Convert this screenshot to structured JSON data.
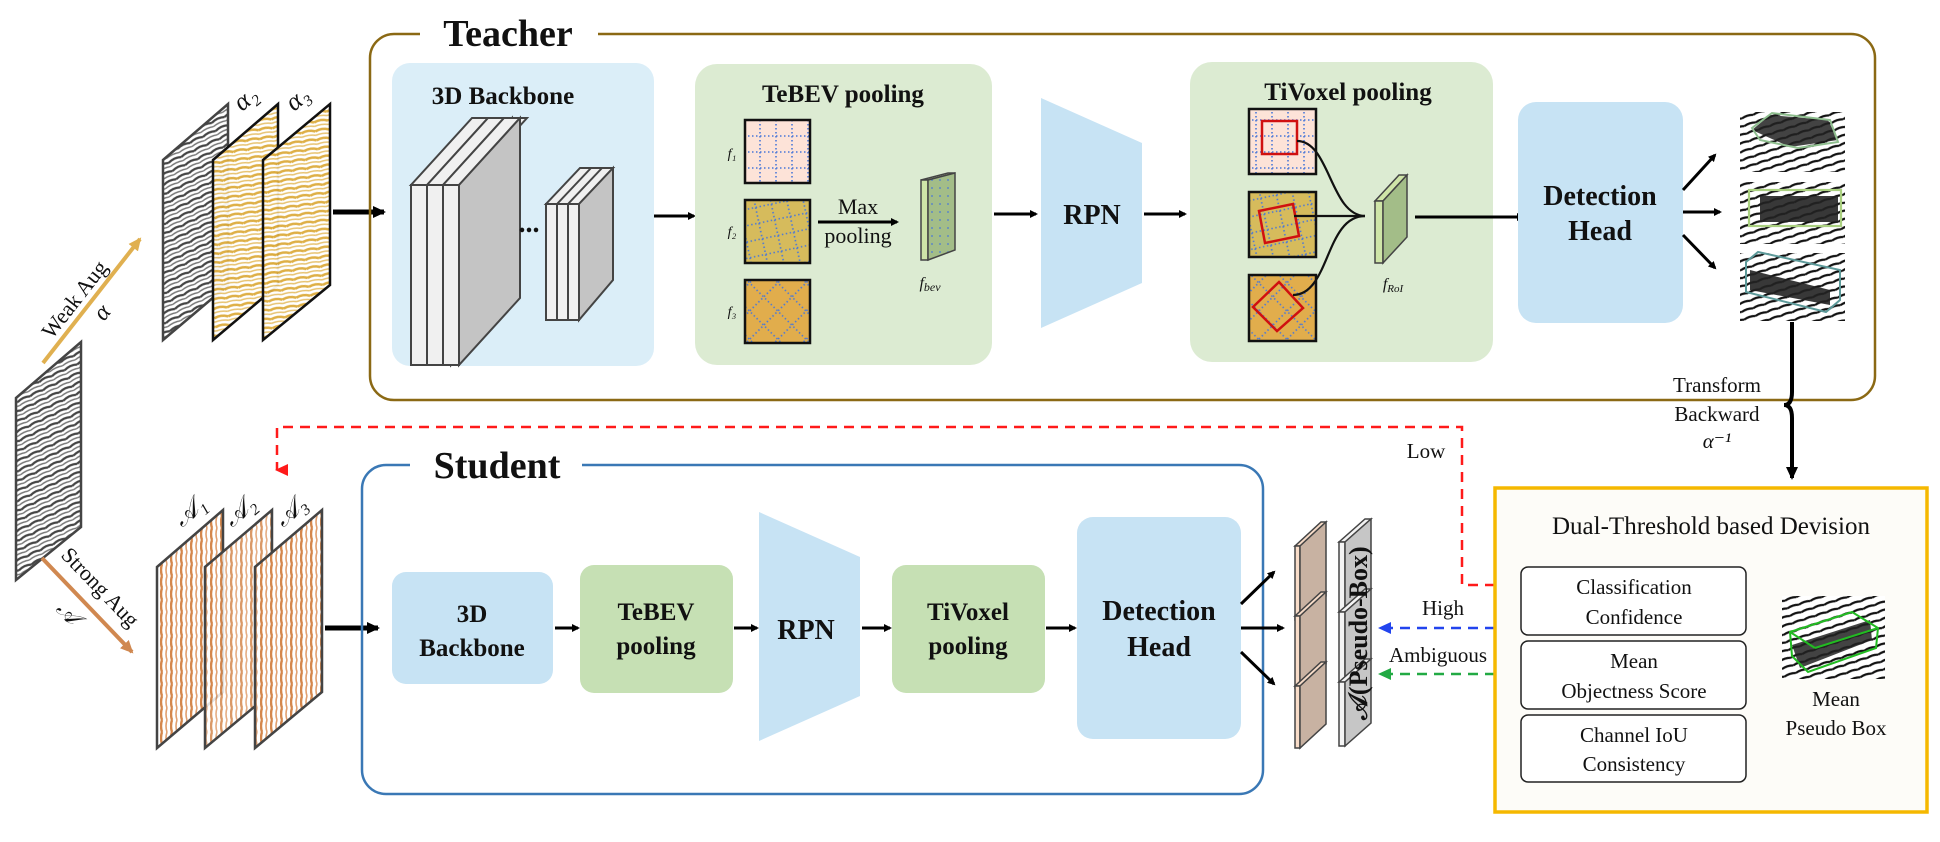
{
  "colors": {
    "teacher_border": "#8b6914",
    "student_border": "#3a78b5",
    "decision_border": "#f5b800",
    "blue_block": "#c7e3f4",
    "blue_block_light": "#dbeef8",
    "green_block": "#c6e0b4",
    "green_block_light": "#dcebd2",
    "weak_aug": "#e0b050",
    "strong_aug": "#d08850",
    "low_line": "#ff1a1a",
    "high_line": "#2244ee",
    "ambiguous_line": "#22aa44"
  },
  "input": {
    "weak_aug_label": "Weak Aug",
    "weak_aug_symbol": "α",
    "strong_aug_label": "Strong Aug",
    "strong_aug_symbol": "𝒜",
    "teacher_views": [
      "α₂",
      "α₃"
    ],
    "student_views": [
      "𝒜₁",
      "𝒜₂",
      "𝒜₃"
    ]
  },
  "teacher": {
    "title": "Teacher",
    "backbone": {
      "title": "3D Backbone",
      "ellipsis": "..."
    },
    "tebev": {
      "title": "TeBEV pooling",
      "features": [
        "f₁",
        "f₂",
        "f₃"
      ],
      "op_line1": "Max",
      "op_line2": "pooling",
      "output": "f",
      "output_sub": "bev"
    },
    "rpn": "RPN",
    "tivoxel": {
      "title": "TiVoxel pooling",
      "output": "f",
      "output_sub": "RoI"
    },
    "detection_head": [
      "Detection",
      "Head"
    ]
  },
  "transform": {
    "line1": "Transform",
    "line2": "Backward",
    "symbol": "α⁻¹"
  },
  "student": {
    "title": "Student",
    "backbone": [
      "3D",
      "Backbone"
    ],
    "tebev": [
      "TeBEV",
      "pooling"
    ],
    "rpn": "RPN",
    "tivoxel": [
      "TiVoxel",
      "pooling"
    ],
    "detection_head": [
      "Detection",
      "Head"
    ],
    "pseudo_box_label": "𝒜(Pseudo-Box)"
  },
  "feedback": {
    "low": "Low",
    "high": "High",
    "ambiguous": "Ambiguous"
  },
  "decision": {
    "title": "Dual-Threshold based Devision",
    "criteria": [
      [
        "Classification",
        "Confidence"
      ],
      [
        "Mean",
        "Objectness Score"
      ],
      [
        "Channel IoU",
        "Consistency"
      ]
    ],
    "mean_box_label": [
      "Mean",
      "Pseudo Box"
    ]
  }
}
